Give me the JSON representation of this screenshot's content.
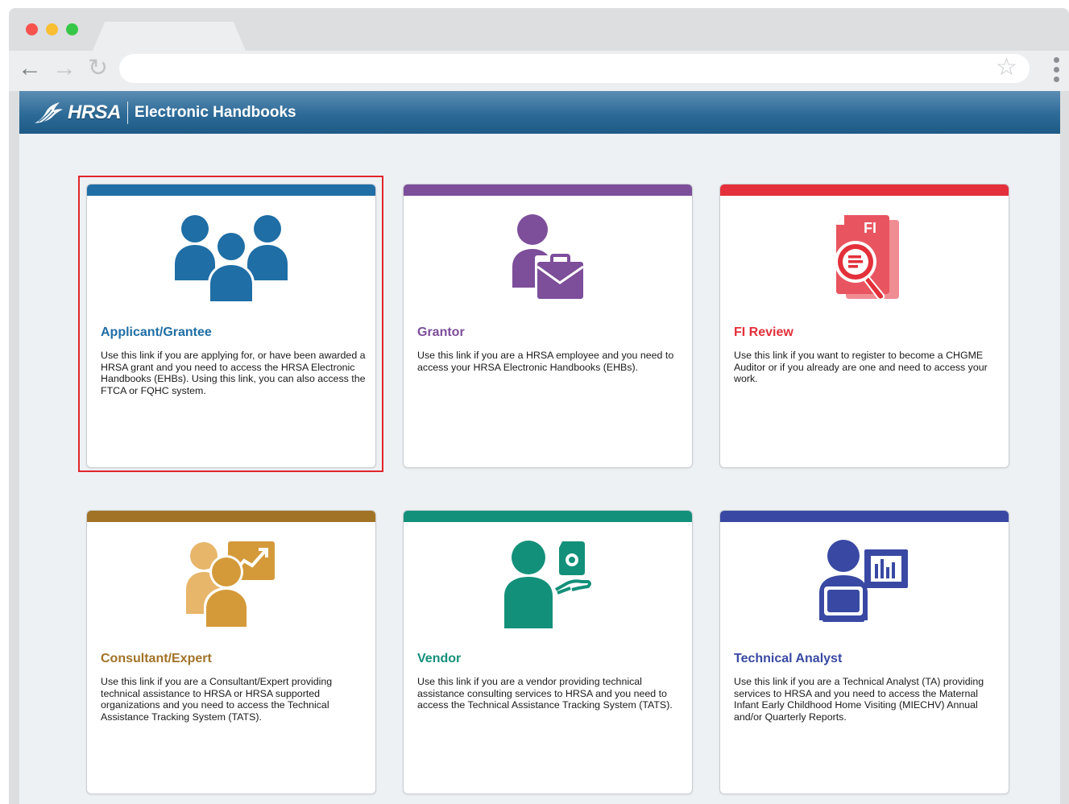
{
  "browser": {
    "address_value": "",
    "address_placeholder": ""
  },
  "header": {
    "logo_text": "HRSA",
    "app_title": "Electronic Handbooks"
  },
  "cards": [
    {
      "title": "Applicant/Grantee",
      "description": "Use this link if you are applying for, or have been awarded a HRSA grant and you need to access the HRSA Electronic Handbooks (EHBs). Using this link, you can also access the FTCA or FQHC system.",
      "color": "#1f6ea5",
      "icon": "group-users-icon",
      "selected": true
    },
    {
      "title": "Grantor",
      "description": "Use this link if you are a HRSA employee and you need to access your HRSA Electronic Handbooks (EHBs).",
      "color": "#7d4e9a",
      "icon": "user-briefcase-icon"
    },
    {
      "title": "FI Review",
      "description": "Use this link if you want to register to become a CHGME Auditor or if you already are one and need to access your work.",
      "color": "#e3303a",
      "icon": "fi-document-search-icon",
      "icon_label": "FI"
    },
    {
      "title": "Consultant/Expert",
      "description": "Use this link if you are a Consultant/Expert providing technical assistance to HRSA or HRSA supported organizations and you need to access the Technical Assistance Tracking System (TATS).",
      "color": "#a17327",
      "icon": "consultant-chart-icon"
    },
    {
      "title": "Vendor",
      "description": "Use this link if you are a vendor providing technical assistance consulting services to HRSA and you need to access the Technical Assistance Tracking System (TATS).",
      "color": "#13907a",
      "icon": "vendor-service-icon"
    },
    {
      "title": "Technical Analyst",
      "description": "Use this link if you are a Technical Analyst (TA) providing services to HRSA and you need to access the Maternal Infant Early Childhood Home Visiting (MIECHV) Annual and/or Quarterly Reports.",
      "color": "#3949a3",
      "icon": "analyst-laptop-chart-icon"
    }
  ]
}
